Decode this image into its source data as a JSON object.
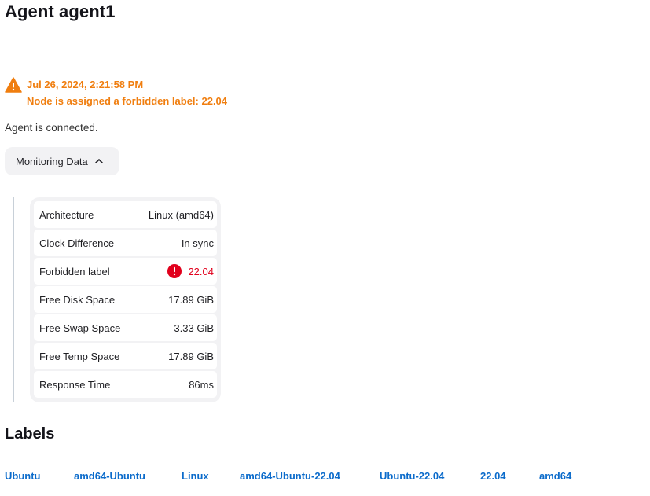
{
  "page_title": "Agent agent1",
  "warning": {
    "timestamp": "Jul 26, 2024, 2:21:58 PM",
    "message": "Node is assigned a forbidden label: 22.04",
    "color": "#f07e0f",
    "icon": "warning-icon"
  },
  "status_text": "Agent is connected.",
  "monitoring": {
    "toggle_label": "Monitoring Data",
    "expanded": true,
    "rows": [
      {
        "label": "Architecture",
        "value": "Linux (amd64)"
      },
      {
        "label": "Clock Difference",
        "value": "In sync"
      },
      {
        "label": "Forbidden label",
        "value": "22.04",
        "error": true,
        "icon": "error-icon"
      },
      {
        "label": "Free Disk Space",
        "value": "17.89 GiB"
      },
      {
        "label": "Free Swap Space",
        "value": "3.33 GiB"
      },
      {
        "label": "Free Temp Space",
        "value": "17.89 GiB"
      },
      {
        "label": "Response Time",
        "value": "86ms"
      }
    ]
  },
  "labels": {
    "title": "Labels",
    "items": [
      "Ubuntu",
      "amd64-Ubuntu",
      "Linux",
      "amd64-Ubuntu-22.04",
      "Ubuntu-22.04",
      "22.04",
      "amd64"
    ]
  },
  "colors": {
    "warning": "#f07e0f",
    "error": "#e1001c",
    "link": "#0b6bcb"
  }
}
